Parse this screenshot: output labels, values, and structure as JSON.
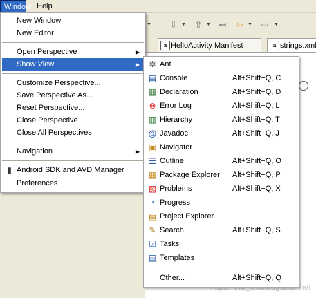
{
  "menubar": {
    "window": "Window",
    "help": "Help"
  },
  "tabs": [
    {
      "label": "HelloActivity Manifest",
      "icon": "android-manifest-icon"
    },
    {
      "label": "strings.xml",
      "icon": "android-xml-icon"
    }
  ],
  "watermark": "https://owl_java.blog.csdn.net",
  "window_menu": {
    "new_window": "New Window",
    "new_editor": "New Editor",
    "open_perspective": "Open Perspective",
    "show_view": "Show View",
    "customize_perspective": "Customize Perspective...",
    "save_perspective_as": "Save Perspective As...",
    "reset_perspective": "Reset Perspective...",
    "close_perspective": "Close Perspective",
    "close_all_perspectives": "Close All Perspectives",
    "navigation": "Navigation",
    "android_sdk": "Android SDK and AVD Manager",
    "preferences": "Preferences"
  },
  "show_view_menu": {
    "items": [
      {
        "label": "Ant",
        "accel": "",
        "icon": "ant-icon"
      },
      {
        "label": "Console",
        "accel": "Alt+Shift+Q, C",
        "icon": "console-icon"
      },
      {
        "label": "Declaration",
        "accel": "Alt+Shift+Q, D",
        "icon": "declaration-icon"
      },
      {
        "label": "Error Log",
        "accel": "Alt+Shift+Q, L",
        "icon": "error-log-icon"
      },
      {
        "label": "Hierarchy",
        "accel": "Alt+Shift+Q, T",
        "icon": "hierarchy-icon"
      },
      {
        "label": "Javadoc",
        "accel": "Alt+Shift+Q, J",
        "icon": "javadoc-icon"
      },
      {
        "label": "Navigator",
        "accel": "",
        "icon": "navigator-icon"
      },
      {
        "label": "Outline",
        "accel": "Alt+Shift+Q, O",
        "icon": "outline-icon"
      },
      {
        "label": "Package Explorer",
        "accel": "Alt+Shift+Q, P",
        "icon": "package-explorer-icon"
      },
      {
        "label": "Problems",
        "accel": "Alt+Shift+Q, X",
        "icon": "problems-icon"
      },
      {
        "label": "Progress",
        "accel": "",
        "icon": "progress-icon"
      },
      {
        "label": "Project Explorer",
        "accel": "",
        "icon": "project-explorer-icon"
      },
      {
        "label": "Search",
        "accel": "Alt+Shift+Q, S",
        "icon": "search-icon"
      },
      {
        "label": "Tasks",
        "accel": "",
        "icon": "tasks-icon"
      },
      {
        "label": "Templates",
        "accel": "",
        "icon": "templates-icon"
      }
    ],
    "other": {
      "label": "Other...",
      "accel": "Alt+Shift+Q, Q"
    }
  },
  "colors": {
    "highlight": "#316ac5",
    "chrome": "#ece9d8",
    "menu_bg": "#ffffff"
  }
}
